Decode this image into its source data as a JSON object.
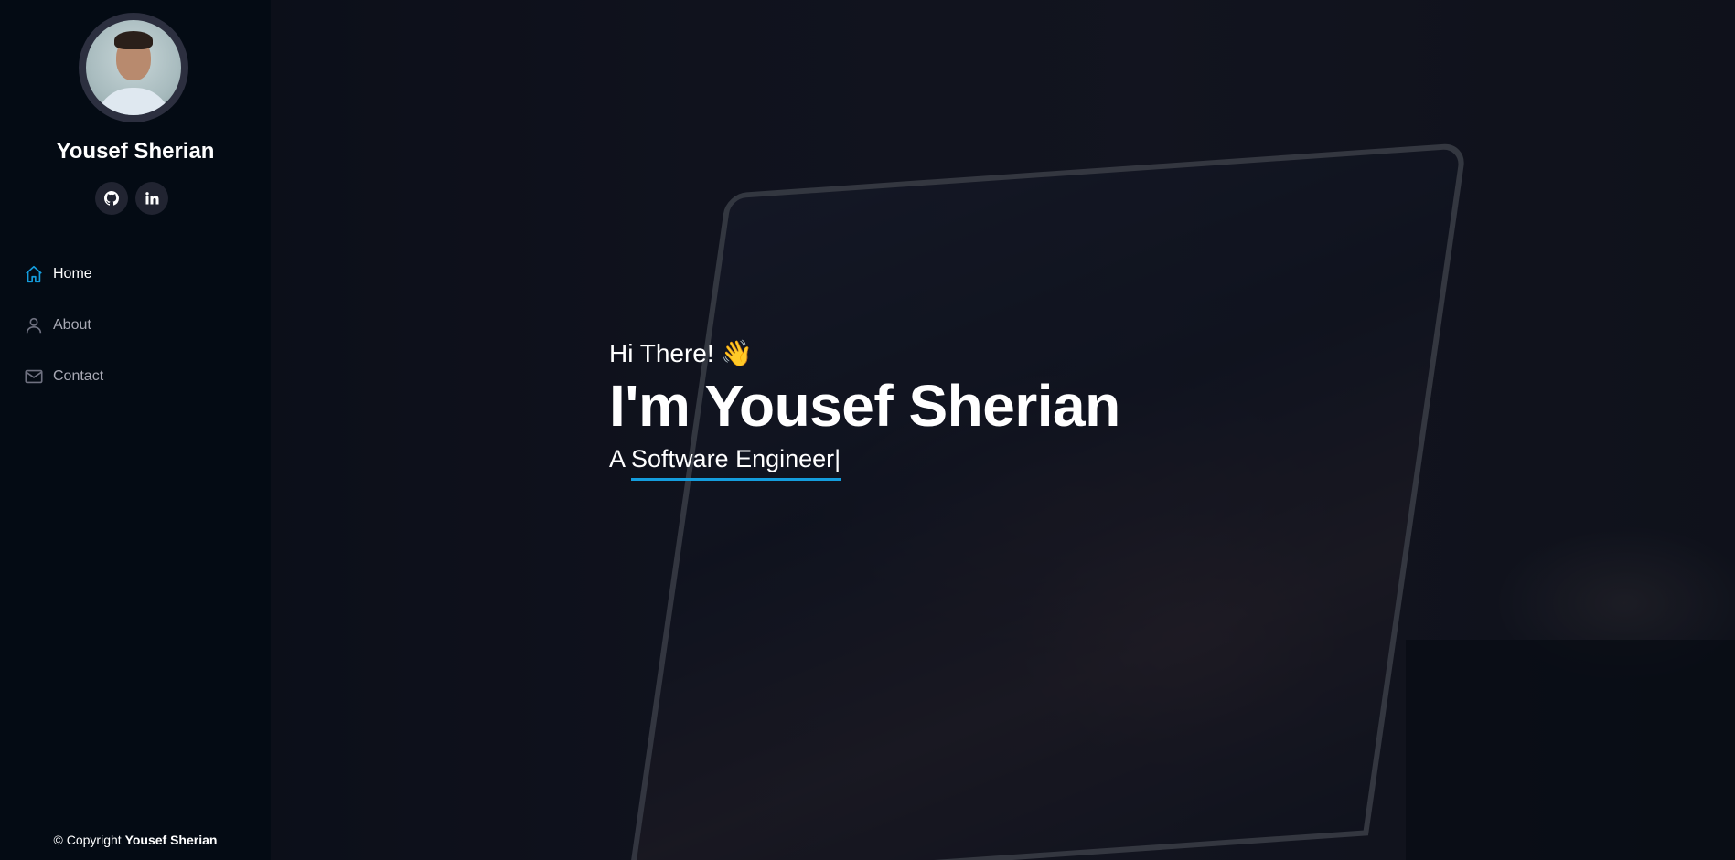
{
  "sidebar": {
    "name": "Yousef Sherian",
    "social": [
      {
        "icon": "github-icon",
        "label": "GitHub"
      },
      {
        "icon": "linkedin-icon",
        "label": "in"
      }
    ],
    "nav": [
      {
        "label": "Home",
        "icon": "home-icon",
        "active": true
      },
      {
        "label": "About",
        "icon": "person-icon",
        "active": false
      },
      {
        "label": "Contact",
        "icon": "envelope-icon",
        "active": false
      }
    ],
    "copyright_prefix": "© Copyright",
    "copyright_name": "Yousef Sherian"
  },
  "hero": {
    "greeting": "Hi There! 👋",
    "headline": "I'm Yousef Sherian",
    "role": "A Software Engineer",
    "cursor": "|"
  },
  "colors": {
    "accent": "#149ddd",
    "sidebar_bg": "#040b14",
    "social_bg": "#212431"
  }
}
